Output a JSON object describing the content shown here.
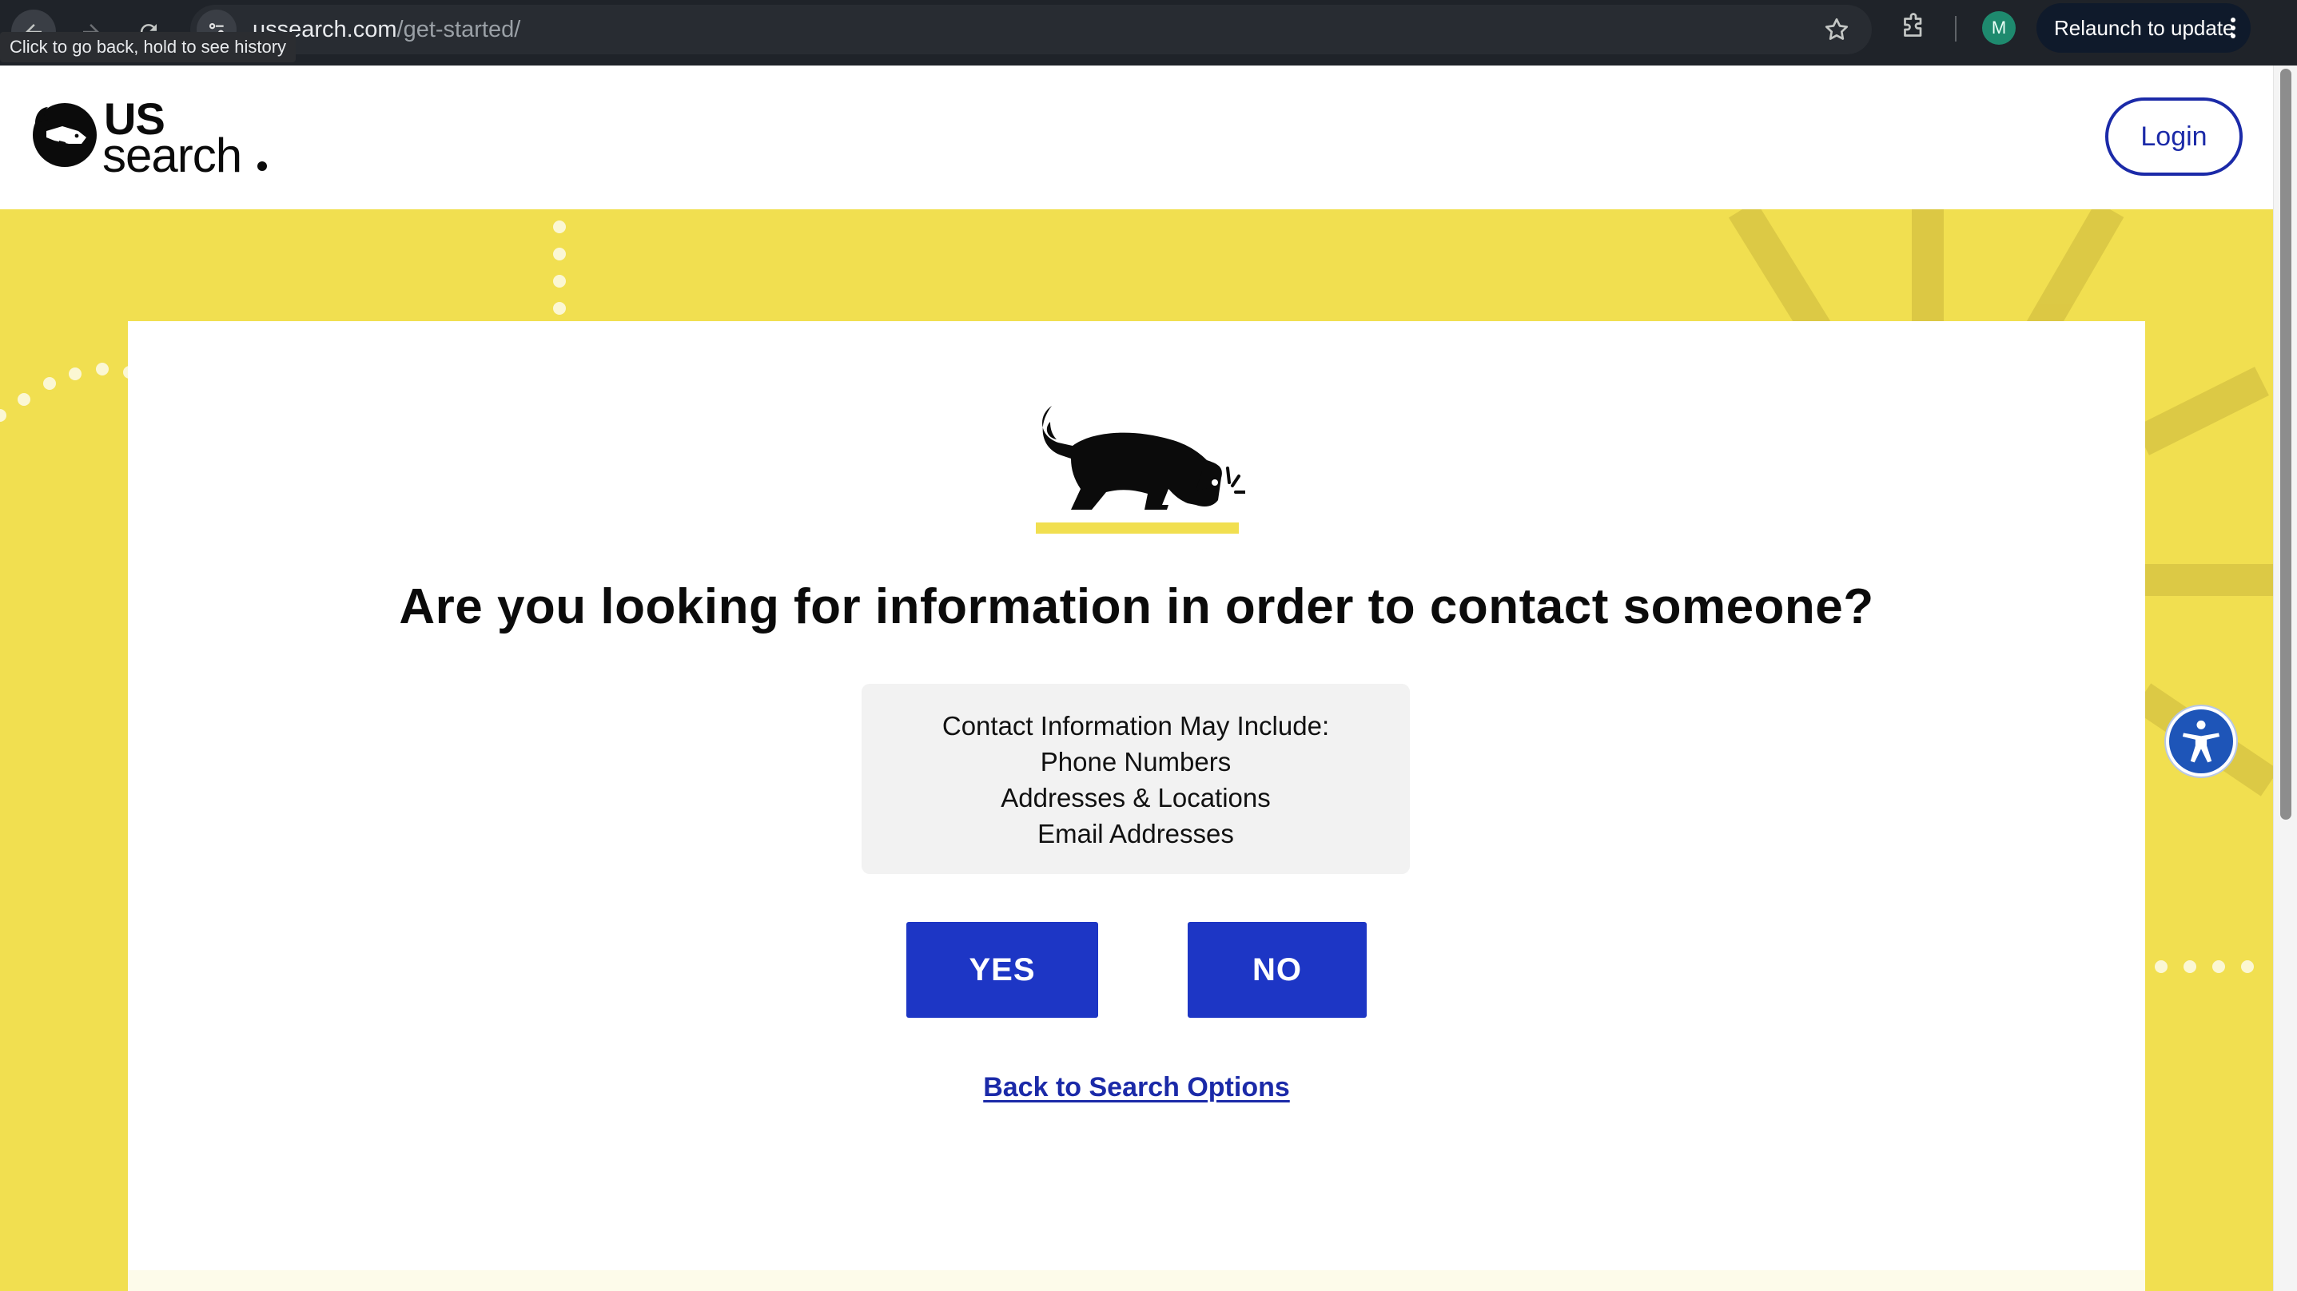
{
  "browser": {
    "url_host": "ussearch.com",
    "url_path": "/get-started/",
    "profile_initial": "M",
    "relaunch_label": "Relaunch to update",
    "back_tooltip": "Click to go back, hold to see history"
  },
  "header": {
    "logo_us": "US",
    "logo_search": "search",
    "login_label": "Login"
  },
  "main": {
    "question": "Are you looking for information in order to contact someone?",
    "info_lines": [
      "Contact Information May Include:",
      "Phone Numbers",
      "Addresses & Locations",
      "Email Addresses"
    ],
    "yes_label": "YES",
    "no_label": "NO",
    "back_link_label": "Back to Search Options"
  },
  "colors": {
    "brand_yellow": "#f1df50",
    "brand_blue": "#1d36c5",
    "link_blue": "#1b2aa8"
  }
}
